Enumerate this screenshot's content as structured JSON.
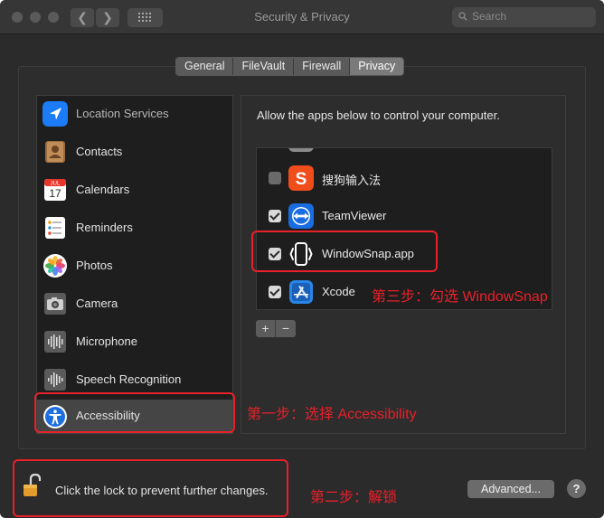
{
  "window": {
    "title": "Security & Privacy",
    "back_arrow": "❮",
    "forward_arrow": "❯"
  },
  "search": {
    "placeholder": "Search"
  },
  "tabs": [
    {
      "label": "General",
      "active": false
    },
    {
      "label": "FileVault",
      "active": false
    },
    {
      "label": "Firewall",
      "active": false
    },
    {
      "label": "Privacy",
      "active": true
    }
  ],
  "sidebar": {
    "items": [
      {
        "label": "Location Services",
        "icon": "location-icon"
      },
      {
        "label": "Contacts",
        "icon": "contacts-icon"
      },
      {
        "label": "Calendars",
        "icon": "calendar-icon",
        "calendar_month": "JUL",
        "calendar_day": "17"
      },
      {
        "label": "Reminders",
        "icon": "reminders-icon"
      },
      {
        "label": "Photos",
        "icon": "photos-icon"
      },
      {
        "label": "Camera",
        "icon": "camera-icon"
      },
      {
        "label": "Microphone",
        "icon": "microphone-icon"
      },
      {
        "label": "Speech Recognition",
        "icon": "speech-recognition-icon"
      },
      {
        "label": "Accessibility",
        "icon": "accessibility-icon",
        "selected": true
      }
    ]
  },
  "main": {
    "description": "Allow the apps below to control your computer.",
    "apps": [
      {
        "label": "搜狗输入法",
        "checked": false,
        "icon": "sogou-icon",
        "icon_glyph": "S"
      },
      {
        "label": "TeamViewer",
        "checked": true,
        "icon": "teamviewer-icon"
      },
      {
        "label": "WindowSnap.app",
        "checked": true,
        "icon": "windowsnap-icon"
      },
      {
        "label": "Xcode",
        "checked": true,
        "icon": "xcode-icon"
      }
    ],
    "add_label": "+",
    "remove_label": "−"
  },
  "footer": {
    "lock_text": "Click the lock to prevent further changes.",
    "advanced_label": "Advanced...",
    "help_label": "?"
  },
  "annotations": {
    "step1": "第一步：选择 Accessibility",
    "step2": "第二步：解锁",
    "step3": "第三步：勾选 WindowSnap"
  },
  "colors": {
    "annotation": "#e8202a",
    "window_bg": "#2b2b2b",
    "sidebar_bg": "#1e1e1e",
    "selected_row": "#454545"
  }
}
